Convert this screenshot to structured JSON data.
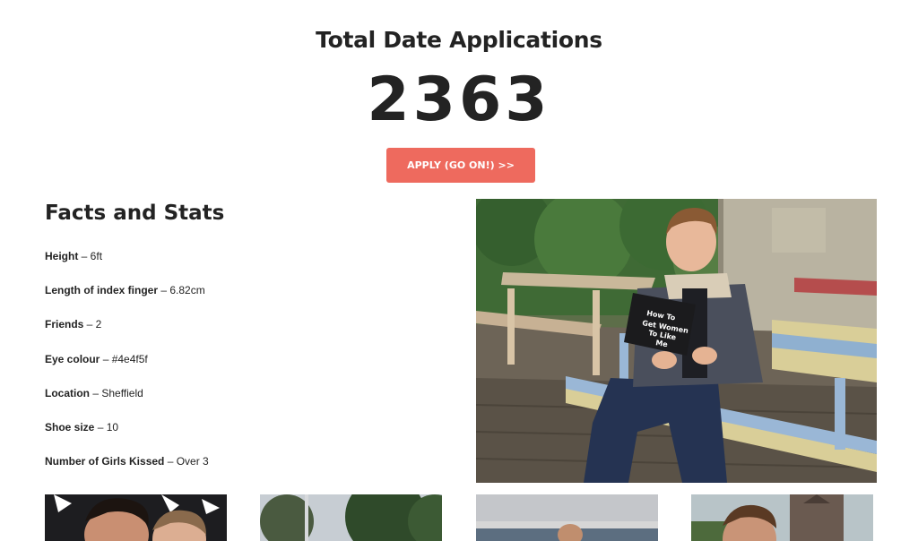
{
  "hero": {
    "title": "Total Date Applications",
    "count": "2363",
    "apply_label": "APPLY (GO ON!) >>"
  },
  "facts": {
    "title": "Facts and Stats",
    "items": [
      {
        "key": "Height",
        "value": " – 6ft"
      },
      {
        "key": "Length of index finger",
        "value": " – 6.82cm"
      },
      {
        "key": "Friends",
        "value": " – 2"
      },
      {
        "key": "Eye colour",
        "value": " – #4e4f5f"
      },
      {
        "key": "Location",
        "value": " – Sheffield"
      },
      {
        "key": "Shoe size",
        "value": " – 10"
      },
      {
        "key": "Number of Girls Kissed",
        "value": " – Over 3"
      }
    ]
  },
  "photo": {
    "book_title_lines": [
      "How To",
      "Get Women",
      "To Like",
      "Me"
    ]
  },
  "colors": {
    "accent": "#ee6a5e",
    "text": "#232323"
  }
}
